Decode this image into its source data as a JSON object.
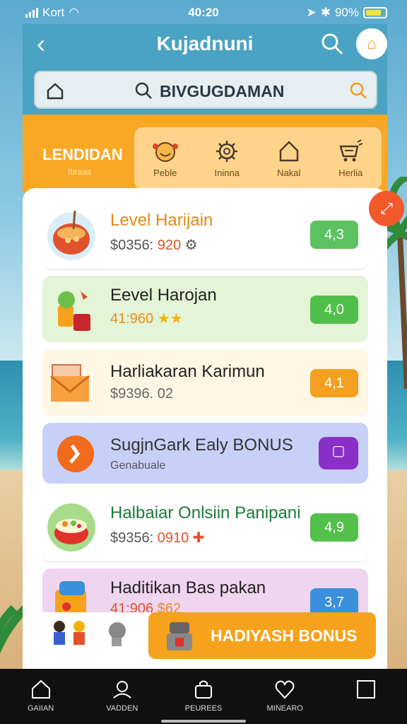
{
  "status": {
    "carrier": "Kort",
    "time": "40:20",
    "battery": "90%"
  },
  "header": {
    "title": "Kujadnuni",
    "search_text": "BIVGUGDAMAN"
  },
  "categories": {
    "main_label": "LENDIDAN",
    "main_sub": "Ibraas",
    "tabs": [
      {
        "label": "Peble",
        "icon": "smile-icon"
      },
      {
        "label": "Ininna",
        "icon": "gear-icon"
      },
      {
        "label": "Nakal",
        "icon": "home-icon"
      },
      {
        "label": "Herlia",
        "icon": "cart-icon"
      }
    ]
  },
  "cards": [
    {
      "name": "Level Harijain",
      "sub_prefix": "$0356:",
      "sub_value": "920",
      "score": "4,3",
      "color": "#5cc160"
    },
    {
      "name": "Eevel Harojan",
      "sub_prefix": "",
      "sub_value": "41:960",
      "score": "4,0",
      "color": "#4fbf4a"
    },
    {
      "name": "Harliakaran Karimun",
      "sub_prefix": "$9396. 02",
      "sub_value": "",
      "score": "4,1",
      "color": "#f4a020"
    },
    {
      "name": "SugjnGark Ealy BONUS",
      "sub_prefix": "Genabuale",
      "sub_value": "",
      "score": "",
      "color": "#8b2fc9"
    },
    {
      "name": "Halbaiar Onlsiin Panipani",
      "sub_prefix": "$9356:",
      "sub_value": "0910",
      "score": "4,9",
      "color": "#52c04a"
    },
    {
      "name": "Haditikan Bas pakan",
      "sub_prefix": "41:906",
      "sub_value": "$62",
      "score": "3,7",
      "color": "#3b8fdc"
    }
  ],
  "bonus": {
    "label": "HADIYASH BONUS"
  },
  "tabbar": {
    "items": [
      "GAIIAN",
      "VADDEN",
      "PEUREES",
      "MINEARO"
    ]
  }
}
